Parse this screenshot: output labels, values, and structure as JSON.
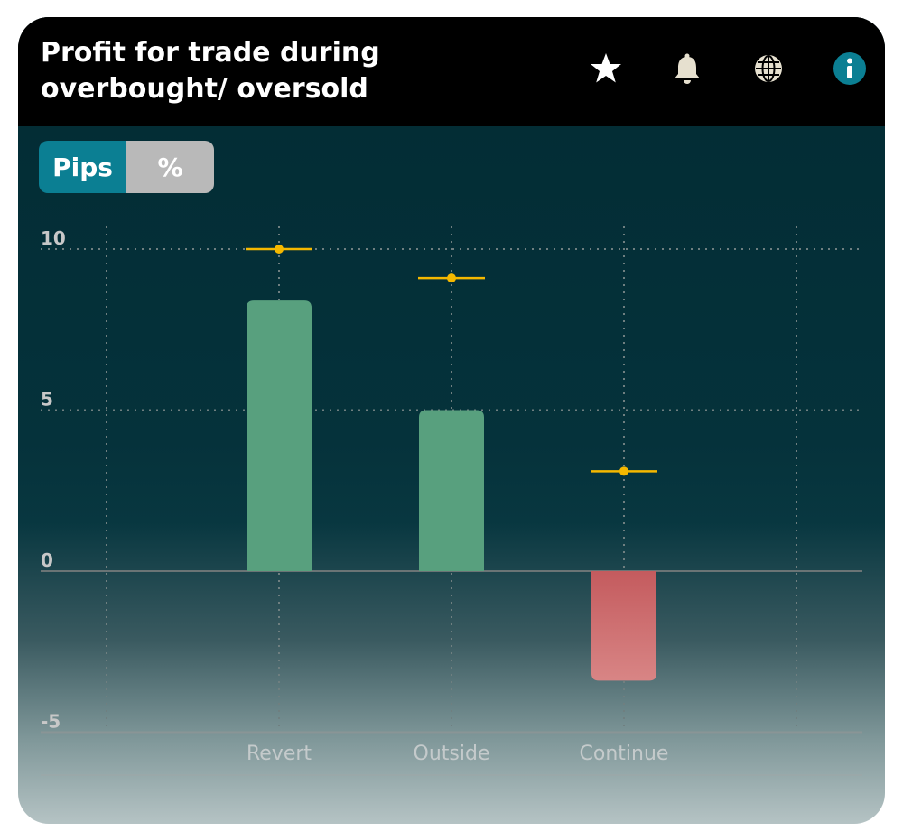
{
  "header": {
    "title": "Profit for trade during overbought/ oversold",
    "icons": [
      "star-icon",
      "bell-icon",
      "globe-icon",
      "info-icon"
    ]
  },
  "toggle": {
    "options": [
      "Pips",
      "%"
    ],
    "selected": "Pips"
  },
  "colors": {
    "positive_bar": "#58a07e",
    "negative_bar_top": "#c45b5e",
    "negative_bar_bottom": "#d88585",
    "marker": "#f5b800",
    "info_accent": "#0b7f93",
    "toggle_active": "#0b7f93",
    "toggle_inactive": "#b9b9b9"
  },
  "chart_data": {
    "type": "bar",
    "categories": [
      "Revert",
      "Outside",
      "Continue"
    ],
    "series": [
      {
        "values": [
          8.4,
          5.0,
          -3.4
        ]
      },
      {
        "values": [
          10.0,
          9.1,
          3.1
        ]
      }
    ],
    "y_ticks": [
      "10",
      "5",
      "0",
      "-5"
    ],
    "ylim": [
      -5,
      10
    ],
    "grid": true
  }
}
